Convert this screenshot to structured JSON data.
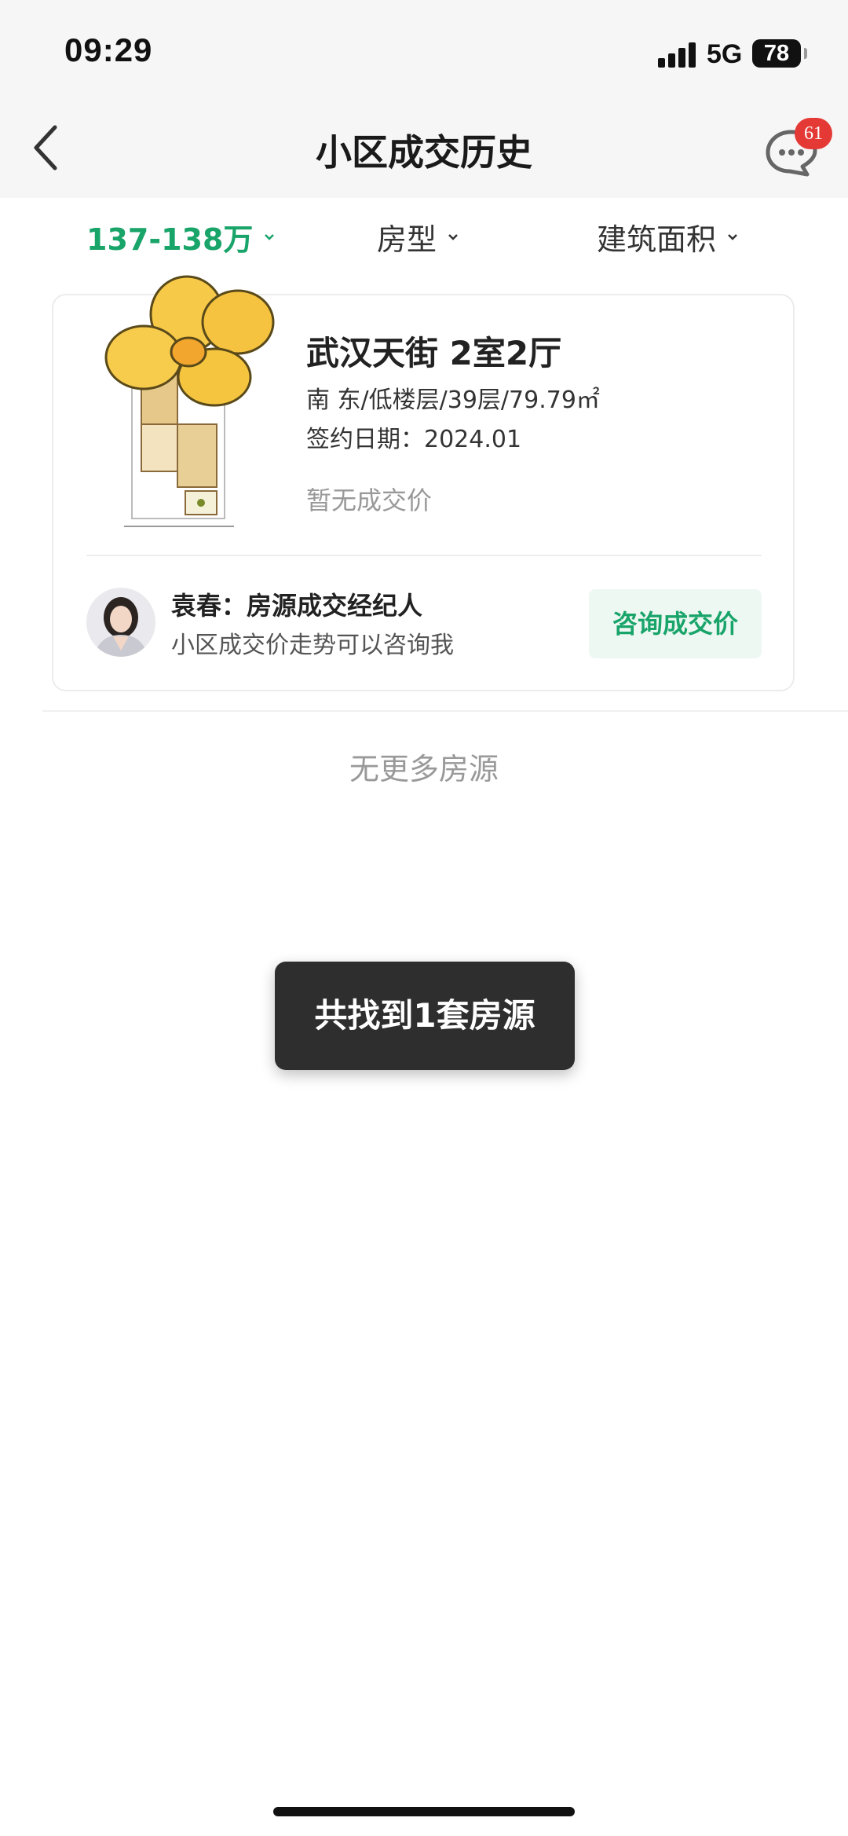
{
  "status_bar": {
    "time": "09:29",
    "network": "5G",
    "battery": "78"
  },
  "nav": {
    "title": "小区成交历史",
    "unread_count": "61"
  },
  "filters": [
    {
      "label": "137-138万",
      "active": true
    },
    {
      "label": "房型",
      "active": false
    },
    {
      "label": "建筑面积",
      "active": false
    }
  ],
  "listing": {
    "title": "武汉天街 2室2厅",
    "info": "南 东/低楼层/39层/79.79㎡",
    "sign_date": "签约日期：2024.01",
    "price_text": "暂无成交价",
    "agent_name": "袁春：房源成交经纪人",
    "agent_desc": "小区成交价走势可以咨询我",
    "consult_label": "咨询成交价"
  },
  "no_more_text": "无更多房源",
  "toast_text": "共找到1套房源",
  "colors": {
    "accent": "#19a46a",
    "badge": "#e53935",
    "toast_bg": "#2e2e2e"
  }
}
